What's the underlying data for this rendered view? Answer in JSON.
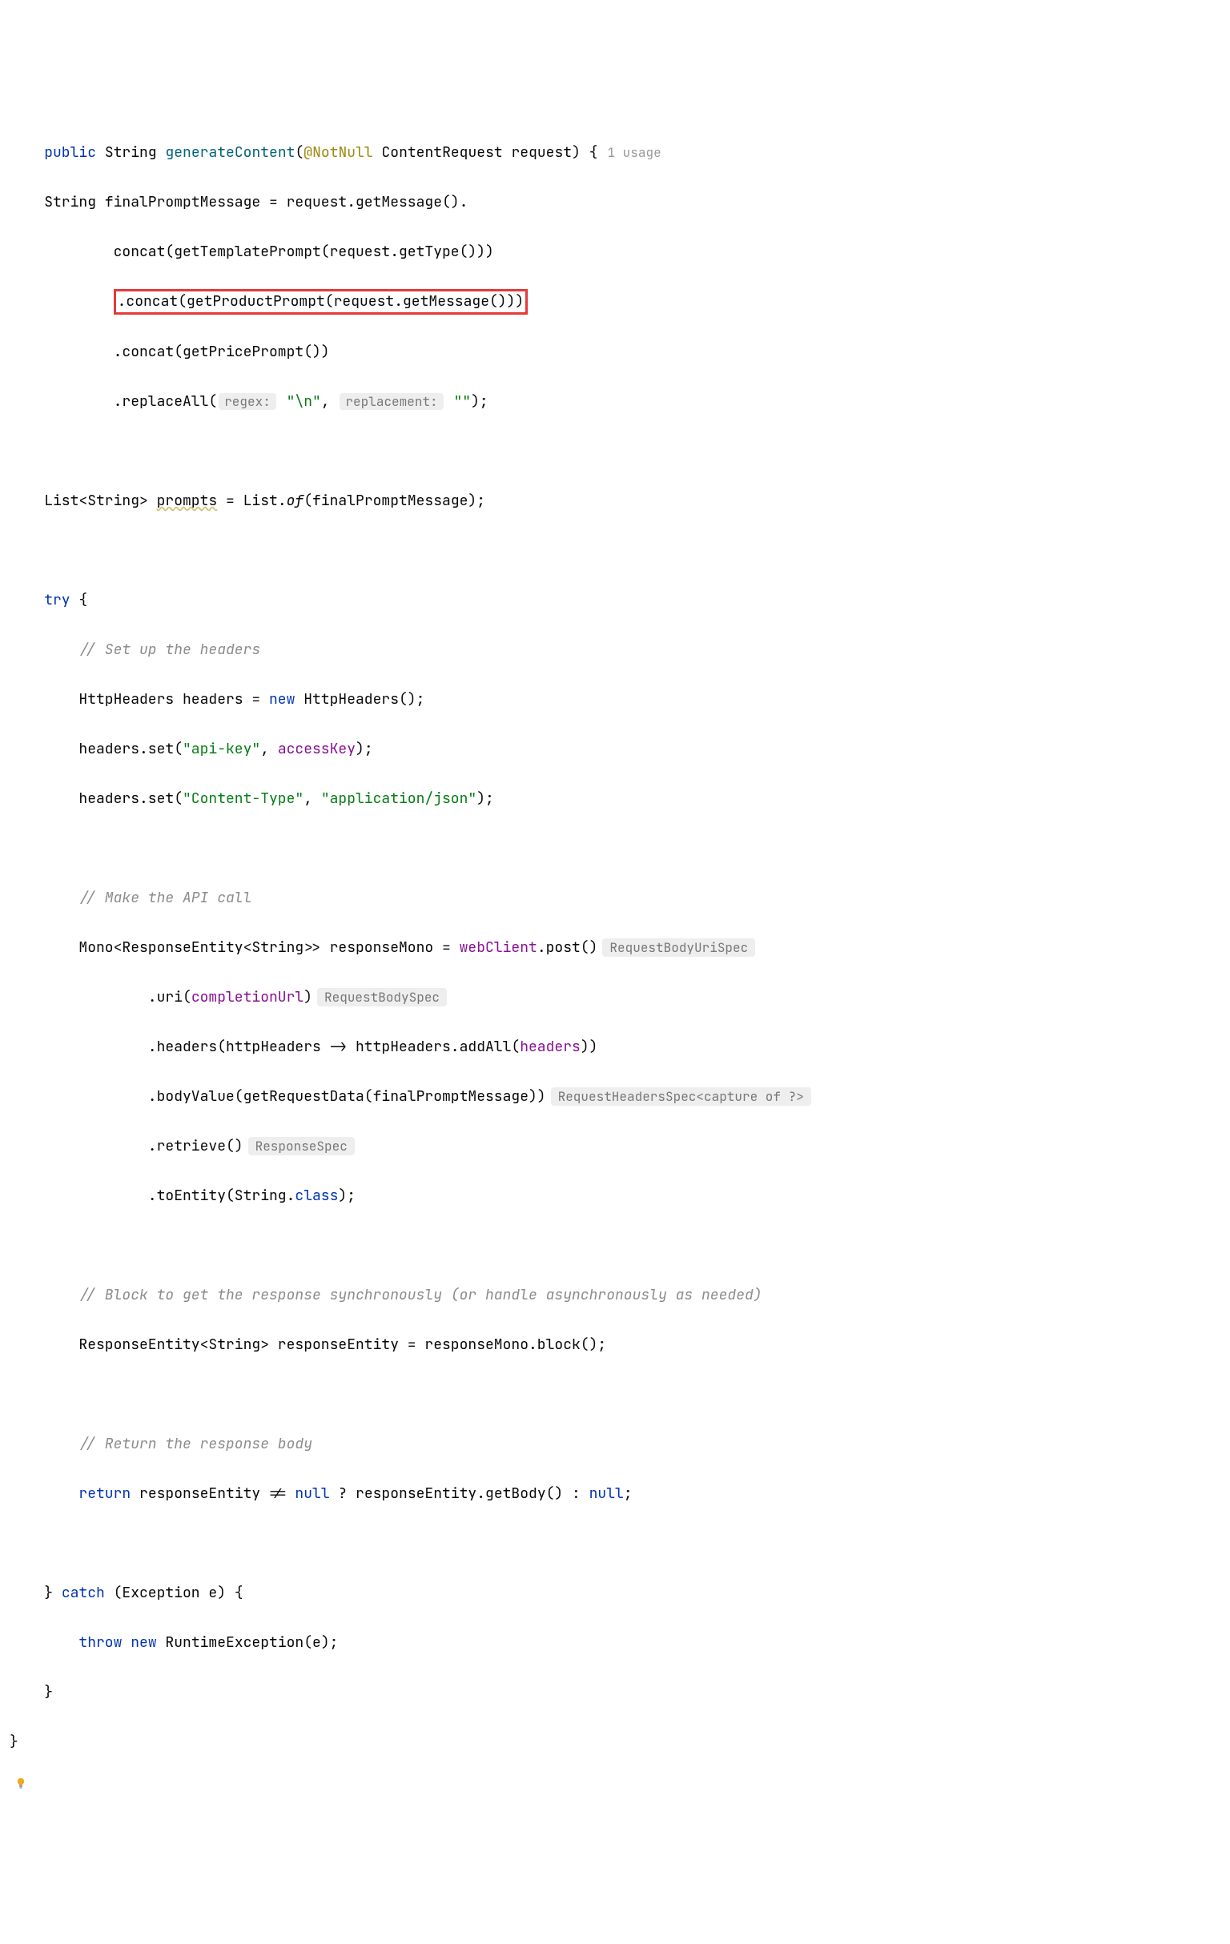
{
  "sig": {
    "public": "public",
    "ret": "String",
    "name": "generateContent",
    "open": "(",
    "anno": "@NotNull",
    "paramType": " ContentRequest request) {",
    "usage": "1 usage"
  },
  "l2a": "    String finalPromptMessage = request.getMessage().",
  "l3": "            concat(getTemplatePrompt(request.getType()))",
  "l4_pre": "            ",
  "l4_box": ".concat(getProductPrompt(request.getMessage()))",
  "l5": "            .concat(getPricePrompt())",
  "l6a": "            .replaceAll(",
  "l6_hint1": "regex:",
  "l6b": " ",
  "l6_str1": "\"\\n\"",
  "l6c": ", ",
  "l6_hint2": "replacement:",
  "l6d": " ",
  "l6_str2": "\"\"",
  "l6e": ");",
  "l8a": "    List<String> ",
  "l8_warn": "prompts",
  "l8b": " = List.",
  "l8_of": "of",
  "l8c": "(finalPromptMessage);",
  "l10_try": "    try",
  "l10b": " {",
  "l11_c": "        // Set up the headers",
  "l12a": "        HttpHeaders headers = ",
  "l12_new": "new",
  "l12b": " HttpHeaders();",
  "l13a": "        headers.set(",
  "l13_s1": "\"api-key\"",
  "l13b": ", ",
  "l13_f": "accessKey",
  "l13c": ");",
  "l14a": "        headers.set(",
  "l14_s1": "\"Content-Type\"",
  "l14b": ", ",
  "l14_s2": "\"application/json\"",
  "l14c": ");",
  "l16_c": "        // Make the API call",
  "l17a": "        Mono<ResponseEntity<String>> responseMono = ",
  "l17_f": "webClient",
  "l17b": ".post()",
  "l17_h": "RequestBodyUriSpec",
  "l18a": "                .uri(",
  "l18_f": "completionUrl",
  "l18b": ")",
  "l18_h": "RequestBodySpec",
  "l19a": "                .headers(httpHeaders -> httpHeaders.addAll(",
  "l19_f": "headers",
  "l19b": "))",
  "l20a": "                .bodyValue(getRequestData(finalPromptMessage))",
  "l20_h": "RequestHeadersSpec<capture of ?>",
  "l21a": "                .retrieve()",
  "l21_h": "ResponseSpec",
  "l22a": "                .toEntity(String.",
  "l22_k": "class",
  "l22b": ");",
  "l24_c": "        // Block to get the response synchronously (or handle asynchronously as needed)",
  "l25": "        ResponseEntity<String> responseEntity = responseMono.block();",
  "l27_c": "        // Return the response body",
  "l28a": "        ",
  "l28_ret": "return",
  "l28b": " responseEntity != ",
  "l28_n1": "null",
  "l28c": " ? responseEntity.getBody() : ",
  "l28_n2": "null",
  "l28d": ";",
  "l30a": "    } ",
  "l30_catch": "catch",
  "l30b": " (Exception e) {",
  "l31a": "        ",
  "l31_throw": "throw",
  "l31b": " ",
  "l31_new": "new",
  "l31c": " RuntimeException(e);",
  "l32": "    }",
  "l33": "}"
}
